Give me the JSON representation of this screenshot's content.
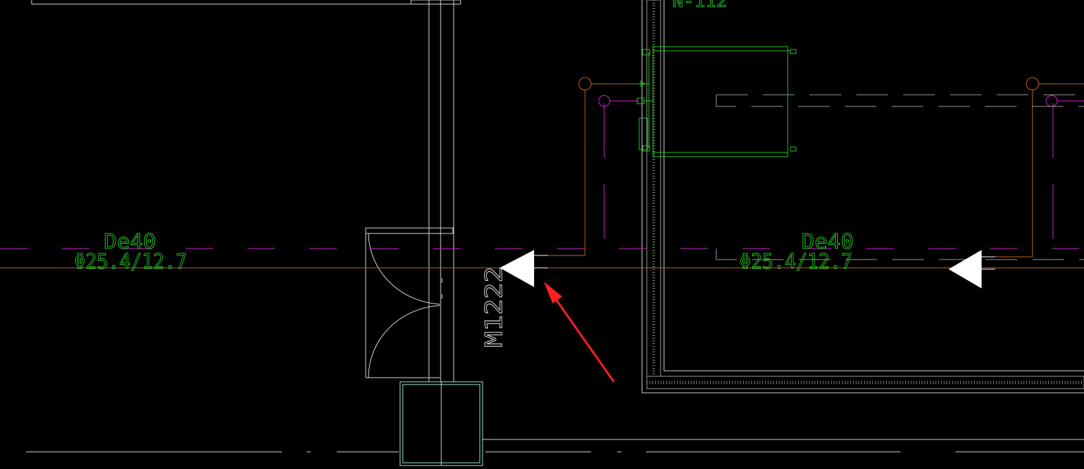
{
  "drawing": {
    "pipe_size_label_left": "De40",
    "insulation_label_left": "Φ25.4/12.7",
    "pipe_size_label_right": "De40",
    "insulation_label_right": "Φ25.4/12.7",
    "door_tag": "M1222",
    "room_tag_partial": "N-112"
  },
  "colors": {
    "background": "#000000",
    "wall": "#d9d9d9",
    "pipe_supply": "#c8641e",
    "pipe_return": "#d21fd2",
    "equipment": "#22c522",
    "text_label": "#22c522",
    "arrow_symbol": "#ffffff",
    "annotation_arrow": "#ff2020",
    "door_frame": "#9fe8c8"
  },
  "icons": {
    "flow_arrow_left": "flow-direction-triangle",
    "flow_arrow_right": "flow-direction-triangle",
    "annotation": "red-pointer-arrow"
  }
}
